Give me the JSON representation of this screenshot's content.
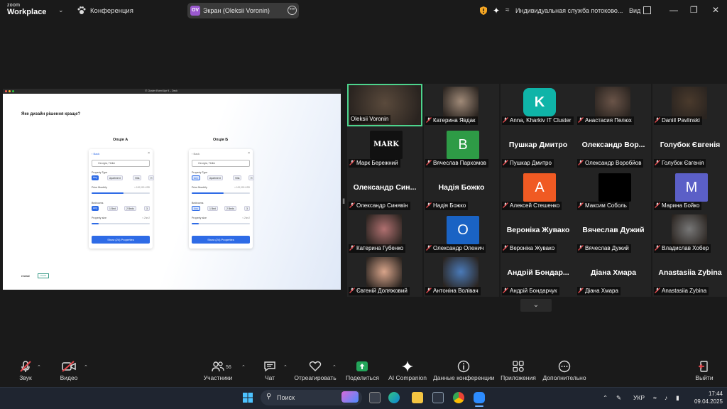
{
  "topbar": {
    "logo_line1": "zoom",
    "logo_line2": "Workplace",
    "conference_label": "Конференция",
    "share_avatar_initials": "OV",
    "share_label": "Экран (Oleksii Voronin)",
    "stream_label": "Индивидуальная служба потоково...",
    "view_label": "Вид"
  },
  "shared_screen": {
    "window_title": "IT Cluster Event Apr 9 – Deck",
    "question": "Яке дизайн рішення краще?",
    "option_a_title": "Опція А",
    "option_b_title": "Опція Б",
    "card": {
      "back": "Back",
      "search_value": "Georgia, Tbilisi",
      "property_type_label": "Property Type",
      "chips_type": [
        "Any",
        "Apartment",
        "Villa",
        "H"
      ],
      "price_label": "Price Monthly",
      "price_hint": "< 100,000 USD",
      "bedrooms_label": "Bedrooms",
      "chips_bedrooms": [
        "Any",
        "1 Bed",
        "2 Beds",
        "3"
      ],
      "size_label": "Property size",
      "size_hint": "< 2hm2",
      "cta": "Show (24) Properties"
    },
    "brand_left": "reveal",
    "brand_right": "cluster"
  },
  "gallery": {
    "tiles": [
      {
        "name": "Oleksii Voronin",
        "avatar": "",
        "color": "#5a4a3c",
        "big": "",
        "muted": false,
        "active": true,
        "photo": true
      },
      {
        "name": "Катерина Явдак",
        "avatar": "",
        "color": "#a08a78",
        "big": "",
        "muted": true,
        "active": false,
        "photo": true
      },
      {
        "name": "Anna, Kharkiv IT Cluster",
        "avatar": "K",
        "color": "#0fb4a8",
        "big": "",
        "muted": true,
        "active": false,
        "photo": false
      },
      {
        "name": "Анастасия Пелюх",
        "avatar": "",
        "color": "#6a5448",
        "big": "",
        "muted": true,
        "active": false,
        "photo": true
      },
      {
        "name": "Daniil Pavlinski",
        "avatar": "",
        "color": "#4a3a2c",
        "big": "",
        "muted": true,
        "active": false,
        "photo": true
      },
      {
        "name": "Марк Бережний",
        "avatar": "MARK",
        "color": "#111111",
        "big": "",
        "muted": true,
        "active": false,
        "photo": false
      },
      {
        "name": "Вячеслав Пархомов",
        "avatar": "B",
        "color": "#2e9b46",
        "big": "",
        "muted": true,
        "active": false,
        "photo": false
      },
      {
        "name": "Пушкар Дмитро",
        "avatar": "",
        "color": "",
        "big": "Пушкар Дмитро",
        "muted": true,
        "active": false,
        "photo": false
      },
      {
        "name": "Олександр Воробйов",
        "avatar": "",
        "color": "",
        "big": "Олександр Вор...",
        "muted": true,
        "active": false,
        "photo": false
      },
      {
        "name": "Голубок Євгенія",
        "avatar": "",
        "color": "",
        "big": "Голубок Євгенія",
        "muted": true,
        "active": false,
        "photo": false
      },
      {
        "name": "Олександр Синявін",
        "avatar": "",
        "color": "",
        "big": "Олександр Син...",
        "muted": true,
        "active": false,
        "photo": false
      },
      {
        "name": "Надія Божко",
        "avatar": "",
        "color": "",
        "big": "Надія Божко",
        "muted": true,
        "active": false,
        "photo": false
      },
      {
        "name": "Алексей Стешенко",
        "avatar": "A",
        "color": "#f05a23",
        "big": "",
        "muted": true,
        "active": false,
        "photo": false
      },
      {
        "name": "Максим Соболь",
        "avatar": "",
        "color": "#000000",
        "big": "",
        "muted": true,
        "active": false,
        "photo": false
      },
      {
        "name": "Марина Бойко",
        "avatar": "M",
        "color": "#5b5fc7",
        "big": "",
        "muted": true,
        "active": false,
        "photo": false
      },
      {
        "name": "Катерина Губенко",
        "avatar": "",
        "color": "#b07070",
        "big": "",
        "muted": true,
        "active": false,
        "photo": true
      },
      {
        "name": "Олександр Оленич",
        "avatar": "O",
        "color": "#1a63c4",
        "big": "",
        "muted": true,
        "active": false,
        "photo": false
      },
      {
        "name": "Вероніка Жувако",
        "avatar": "",
        "color": "",
        "big": "Вероніка Жувако",
        "muted": true,
        "active": false,
        "photo": false
      },
      {
        "name": "Вячеслав Дужий",
        "avatar": "",
        "color": "",
        "big": "Вячеслав Дужий",
        "muted": true,
        "active": false,
        "photo": false
      },
      {
        "name": "Владислав Хобер",
        "avatar": "",
        "color": "#777777",
        "big": "",
        "muted": true,
        "active": false,
        "photo": true
      },
      {
        "name": "Євгеній Доляжовий",
        "avatar": "",
        "color": "#d8a48a",
        "big": "",
        "muted": true,
        "active": false,
        "photo": true
      },
      {
        "name": "Антоніна Волівач",
        "avatar": "",
        "color": "#4a7ab8",
        "big": "",
        "muted": true,
        "active": false,
        "photo": true
      },
      {
        "name": "Андрій Бондарчук",
        "avatar": "",
        "color": "",
        "big": "Андрій Бондар...",
        "muted": true,
        "active": false,
        "photo": false
      },
      {
        "name": "Діана Хмара",
        "avatar": "",
        "color": "",
        "big": "Діана Хмара",
        "muted": true,
        "active": false,
        "photo": false
      },
      {
        "name": "Anastasiia Zybina",
        "avatar": "",
        "color": "",
        "big": "Anastasiia Zybina",
        "muted": true,
        "active": false,
        "photo": false
      }
    ]
  },
  "toolbar": {
    "audio": "Звук",
    "video": "Видео",
    "participants": "Участники",
    "participants_count": "56",
    "chat": "Чат",
    "react": "Отреагировать",
    "share": "Поделиться",
    "ai": "AI Companion",
    "meeting_info": "Данные конференции",
    "apps": "Приложения",
    "more": "Дополнительно",
    "leave": "Выйти"
  },
  "taskbar": {
    "search_label": "Поиск",
    "lang": "УКР",
    "time": "17:44",
    "date": "09.04.2025"
  },
  "colors": {
    "accent": "#2e6be6",
    "active_speaker": "#4dd48d",
    "muted_red": "#e5484d",
    "share_green": "#23a55a"
  }
}
